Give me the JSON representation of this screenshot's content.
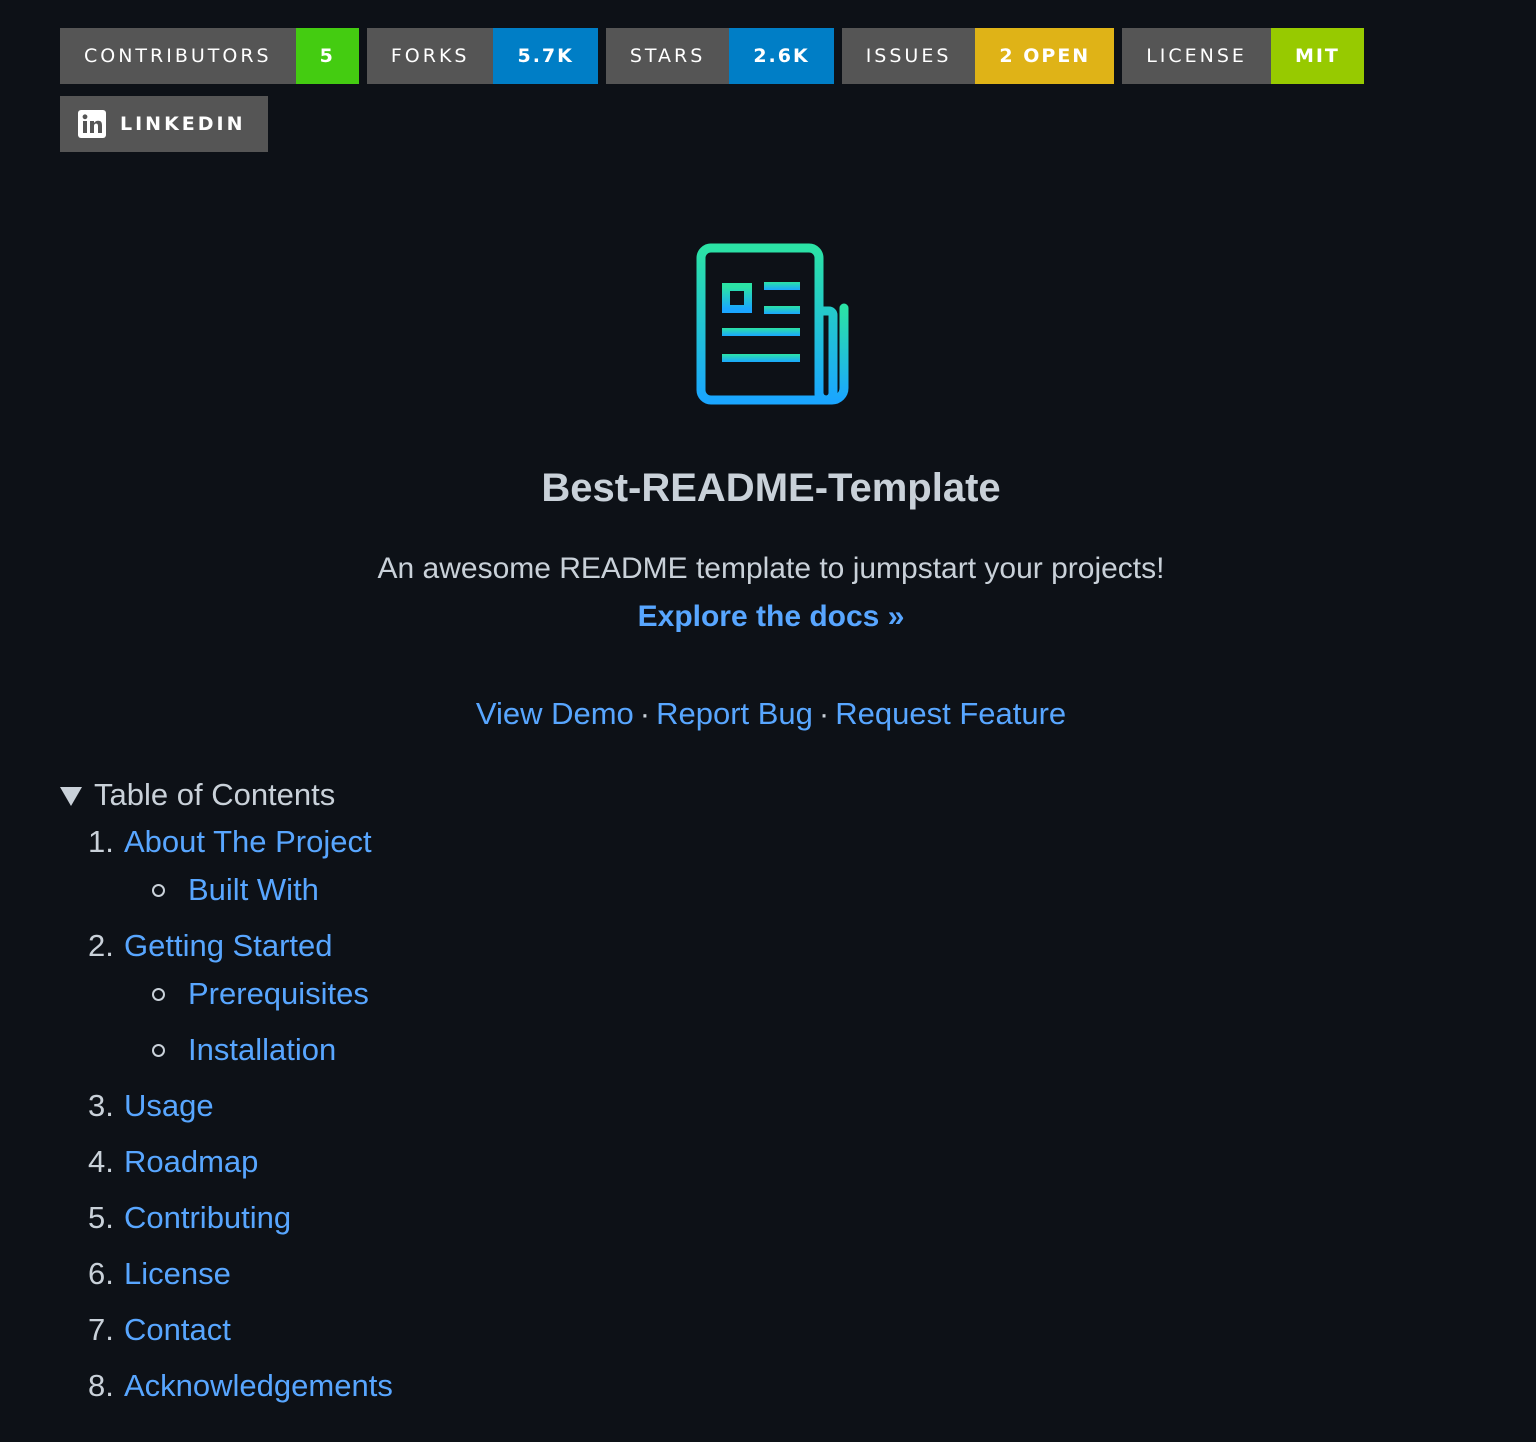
{
  "badges": [
    {
      "label": "CONTRIBUTORS",
      "value": "5",
      "color": "#4c1"
    },
    {
      "label": "FORKS",
      "value": "5.7K",
      "color": "#007ec6"
    },
    {
      "label": "STARS",
      "value": "2.6K",
      "color": "#007ec6"
    },
    {
      "label": "ISSUES",
      "value": "2 OPEN",
      "color": "#dfb317"
    },
    {
      "label": "LICENSE",
      "value": "MIT",
      "color": "#97ca00"
    }
  ],
  "linkedin": {
    "label": "LINKEDIN",
    "icon": "linkedin-icon"
  },
  "logo": {
    "icon": "newspaper-icon",
    "gradient_top": "#2be3a5",
    "gradient_bottom": "#1aa6ff"
  },
  "header": {
    "title": "Best-README-Template",
    "tagline": "An awesome README template to jumpstart your projects!",
    "docs_link": "Explore the docs »",
    "view_demo": "View Demo",
    "report_bug": "Report Bug",
    "request_feature": "Request Feature",
    "separator": "·"
  },
  "toc": {
    "summary": "Table of Contents",
    "items": [
      {
        "num": "1.",
        "label": "About The Project"
      },
      {
        "label": "Built With"
      },
      {
        "num": "2.",
        "label": "Getting Started"
      },
      {
        "label": "Prerequisites"
      },
      {
        "label": "Installation"
      },
      {
        "num": "3.",
        "label": "Usage"
      },
      {
        "num": "4.",
        "label": "Roadmap"
      },
      {
        "num": "5.",
        "label": "Contributing"
      },
      {
        "num": "6.",
        "label": "License"
      },
      {
        "num": "7.",
        "label": "Contact"
      },
      {
        "num": "8.",
        "label": "Acknowledgements"
      }
    ]
  },
  "colors": {
    "background": "#0d1117",
    "text": "#c9d1d9",
    "link": "#58a6ff",
    "badge_label": "#555555"
  }
}
